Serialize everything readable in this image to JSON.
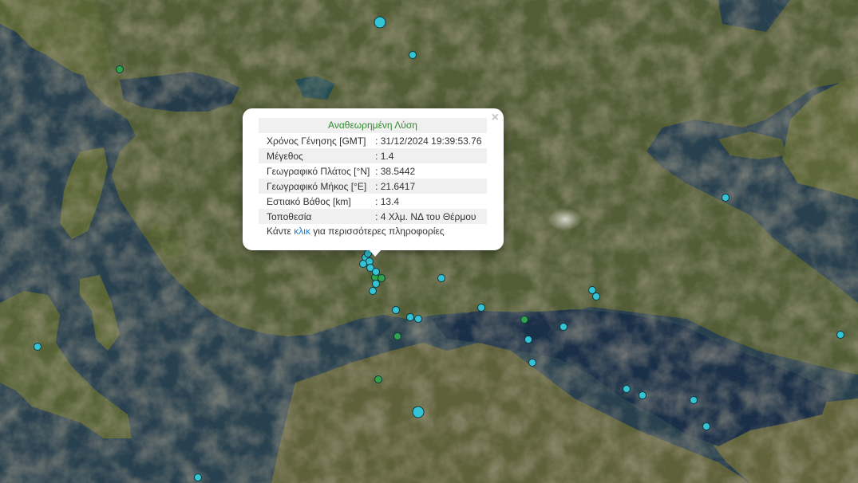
{
  "map": {
    "colors": {
      "sea": "#1f3a4c",
      "gulf": "#0f2744",
      "land_green": "#4d5b2e",
      "land_brown": "#6b5a3e",
      "mountain": "#7d6a55",
      "marker_cyan": "#35c4d6",
      "marker_green": "#2fa24a",
      "marker_stroke": "#0b3a3f"
    },
    "markers": [
      {
        "type": "cyan",
        "size": "large"
      },
      {
        "type": "cyan",
        "size": "small"
      },
      {
        "type": "green",
        "size": "small"
      },
      {
        "type": "cyan",
        "size": "small"
      },
      {
        "type": "cyan",
        "size": "small"
      },
      {
        "type": "cyan",
        "size": "small"
      },
      {
        "type": "cyan",
        "size": "small"
      },
      {
        "type": "green",
        "size": "small"
      },
      {
        "type": "green",
        "size": "small"
      },
      {
        "type": "cyan",
        "size": "small"
      },
      {
        "type": "cyan",
        "size": "small"
      },
      {
        "type": "cyan",
        "size": "small"
      },
      {
        "type": "cyan",
        "size": "small"
      },
      {
        "type": "cyan",
        "size": "small"
      },
      {
        "type": "cyan",
        "size": "small"
      },
      {
        "type": "cyan",
        "size": "small"
      },
      {
        "type": "cyan",
        "size": "small"
      },
      {
        "type": "cyan",
        "size": "small"
      },
      {
        "type": "green",
        "size": "small"
      },
      {
        "type": "cyan",
        "size": "small"
      },
      {
        "type": "green",
        "size": "small"
      },
      {
        "type": "cyan",
        "size": "small"
      },
      {
        "type": "cyan",
        "size": "small"
      },
      {
        "type": "cyan",
        "size": "small"
      },
      {
        "type": "cyan",
        "size": "small"
      },
      {
        "type": "cyan",
        "size": "small"
      },
      {
        "type": "cyan",
        "size": "small"
      },
      {
        "type": "cyan",
        "size": "small"
      },
      {
        "type": "cyan",
        "size": "large"
      },
      {
        "type": "cyan",
        "size": "small"
      },
      {
        "type": "cyan",
        "size": "small"
      },
      {
        "type": "cyan",
        "size": "small"
      },
      {
        "type": "green",
        "size": "small"
      },
      {
        "type": "cyan",
        "size": "small"
      },
      {
        "type": "cyan",
        "size": "small"
      }
    ]
  },
  "popup": {
    "title": "Αναθεωρημένη Λύση",
    "close_symbol": "×",
    "rows": [
      {
        "label": "Χρόνος Γένησης [GMT]",
        "value": ": 31/12/2024 19:39:53.76"
      },
      {
        "label": "Μέγεθος",
        "value": ": 1.4"
      },
      {
        "label": "Γεωγραφικό Πλάτος [°N]",
        "value": ": 38.5442"
      },
      {
        "label": "Γεωγραφικό Μήκος [°E]",
        "value": ": 21.6417"
      },
      {
        "label": "Εστιακό Βάθος [km]",
        "value": ": 13.4"
      },
      {
        "label": "Τοποθεσία",
        "value": ": 4 Χλμ. ΝΔ του Θέρμου"
      }
    ],
    "more_prefix": "Κάντε ",
    "more_link": "κλικ",
    "more_suffix": " για περισσότερες πληροφορίες"
  }
}
